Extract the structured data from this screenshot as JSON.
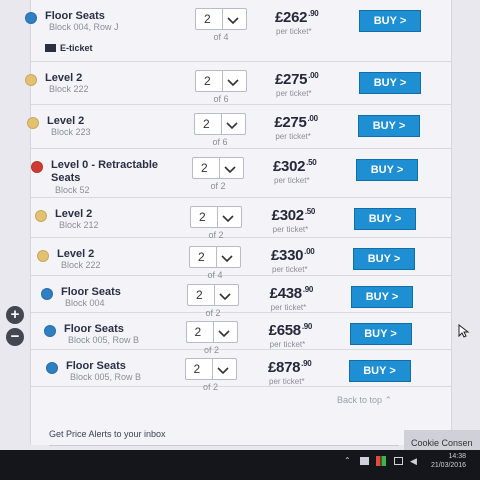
{
  "listings": [
    {
      "name": "Floor Seats",
      "block": "Block 004, Row J",
      "eticket": "E-ticket",
      "qty": "2",
      "of": "of 4",
      "price_main": "£262",
      "price_pence": ".90",
      "per": "per ticket*",
      "buy": "BUY >",
      "color": "#2f7fc3"
    },
    {
      "name": "Level 2",
      "block": "Block 222",
      "qty": "2",
      "of": "of 6",
      "price_main": "£275",
      "price_pence": ".00",
      "per": "per ticket*",
      "buy": "BUY >",
      "color": "#e3c16f"
    },
    {
      "name": "Level 2",
      "block": "Block 223",
      "qty": "2",
      "of": "of 6",
      "price_main": "£275",
      "price_pence": ".00",
      "per": "per ticket*",
      "buy": "BUY >",
      "color": "#e3c16f"
    },
    {
      "name": "Level 0 - Retractable Seats",
      "block": "Block 52",
      "qty": "2",
      "of": "of 2",
      "price_main": "£302",
      "price_pence": ".50",
      "per": "per ticket*",
      "buy": "BUY >",
      "color": "#d03a35"
    },
    {
      "name": "Level 2",
      "block": "Block 212",
      "qty": "2",
      "of": "of 2",
      "price_main": "£302",
      "price_pence": ".50",
      "per": "per ticket*",
      "buy": "BUY >",
      "color": "#e3c16f"
    },
    {
      "name": "Level 2",
      "block": "Block 222",
      "qty": "2",
      "of": "of 4",
      "price_main": "£330",
      "price_pence": ".00",
      "per": "per ticket*",
      "buy": "BUY >",
      "color": "#e3c16f"
    },
    {
      "name": "Floor Seats",
      "block": "Block 004",
      "qty": "2",
      "of": "of 2",
      "price_main": "£438",
      "price_pence": ".90",
      "per": "per ticket*",
      "buy": "BUY >",
      "color": "#2f7fc3"
    },
    {
      "name": "Floor Seats",
      "block": "Block 005, Row B",
      "qty": "2",
      "of": "of 2",
      "price_main": "£658",
      "price_pence": ".90",
      "per": "per ticket*",
      "buy": "BUY >",
      "color": "#2f7fc3"
    },
    {
      "name": "Floor Seats",
      "block": "Block 005, Row B",
      "qty": "2",
      "of": "of 2",
      "price_main": "£878",
      "price_pence": ".90",
      "per": "per ticket*",
      "buy": "BUY >",
      "color": "#2f7fc3"
    }
  ],
  "back_to_top": "Back to top",
  "price_alerts": "Get Price Alerts to your inbox",
  "cookie": "Cookie Consen",
  "zoom_in": "+",
  "zoom_out": "−",
  "clock": {
    "time": "14:38",
    "date": "21/03/2016"
  }
}
